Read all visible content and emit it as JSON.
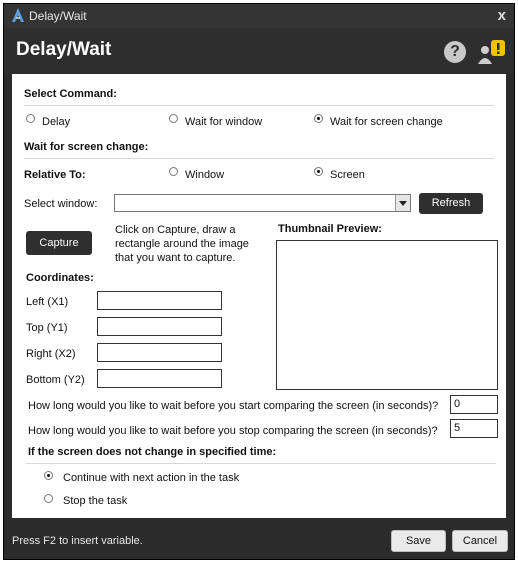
{
  "window": {
    "title": "Delay/Wait",
    "close": "x",
    "header_title": "Delay/Wait",
    "help_glyph": "?",
    "warn_glyph": "!",
    "accent": "#f2c100"
  },
  "select_command": {
    "heading": "Select Command:",
    "options": [
      "Delay",
      "Wait for window",
      "Wait for screen change"
    ],
    "selected": "Wait for screen change"
  },
  "section_title": "Wait for screen change:",
  "relative_to": {
    "label": "Relative To:",
    "options": [
      "Window",
      "Screen"
    ],
    "selected": "Screen"
  },
  "select_window": {
    "label": "Select window:",
    "value": "",
    "refresh_label": "Refresh"
  },
  "capture": {
    "button_label": "Capture",
    "instructions": [
      "Click on Capture, draw a",
      "rectangle around the image",
      "that you want to capture."
    ]
  },
  "thumbnail_label": "Thumbnail Preview:",
  "coordinates": {
    "heading": "Coordinates:",
    "fields": [
      {
        "label": "Left (X1)",
        "value": ""
      },
      {
        "label": "Top (Y1)",
        "value": ""
      },
      {
        "label": "Right (X2)",
        "value": ""
      },
      {
        "label": "Bottom (Y2)",
        "value": ""
      }
    ]
  },
  "wait_start": {
    "question": "How long would you like to wait before you start comparing the screen (in seconds)?",
    "value": "0"
  },
  "wait_stop": {
    "question": "How long would you like to wait before you stop comparing the screen (in seconds)?",
    "value": "5"
  },
  "no_change": {
    "heading": "If the screen does not change in specified time:",
    "options": [
      "Continue with next action in the task",
      "Stop the task"
    ],
    "selected": "Continue with next action in the task"
  },
  "footer": {
    "hint": "Press F2 to insert variable.",
    "save_label": "Save",
    "cancel_label": "Cancel"
  }
}
